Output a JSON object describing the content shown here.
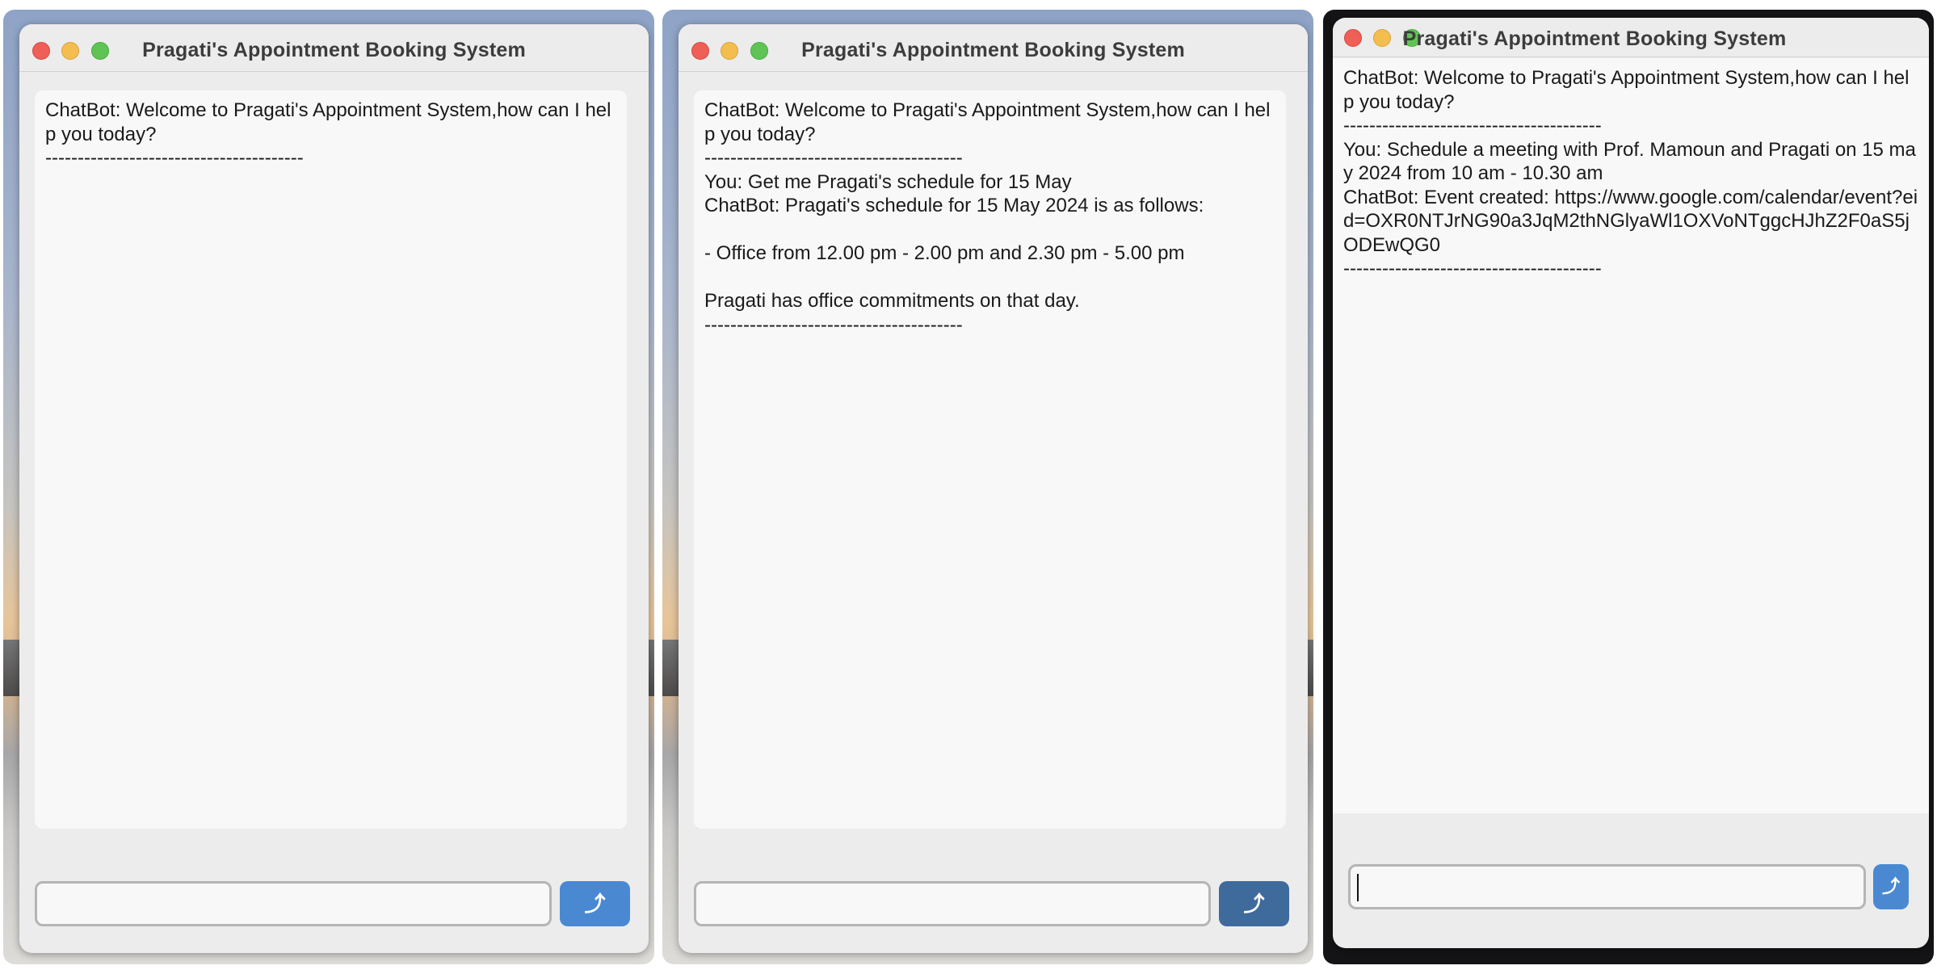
{
  "windows": [
    {
      "title": "Pragati's Appointment Booking System",
      "chat_lines": [
        "ChatBot: Welcome to Pragati's Appointment System,how can I help you today?\n----------------------------------------"
      ],
      "input_value": "",
      "send_icon": "arrow-up-icon",
      "send_glyph": "⤴"
    },
    {
      "title": "Pragati's Appointment Booking System",
      "chat_lines": [
        "ChatBot: Welcome to Pragati's Appointment System,how can I help you today?\n----------------------------------------\nYou: Get me Pragati's schedule for 15 May\nChatBot: Pragati's schedule for 15 May 2024 is as follows:\n\n- Office from 12.00 pm - 2.00 pm and 2.30 pm - 5.00 pm\n\nPragati has office commitments on that day.\n----------------------------------------"
      ],
      "input_value": "",
      "send_icon": "arrow-up-icon",
      "send_glyph": "⤴"
    },
    {
      "title": "Pragati's Appointment Booking System",
      "chat_lines": [
        "ChatBot: Welcome to Pragati's Appointment System,how can I help you today?\n----------------------------------------\nYou: Schedule a meeting with Prof. Mamoun and Pragati on 15 may 2024 from 10 am - 10.30 am\nChatBot: Event created: https://www.google.com/calendar/event?eid=OXR0NTJrNG90a3JqM2thNGlyaWl1OXVoNTggcHJhZ2F0aS5jODEwQG0\n----------------------------------------"
      ],
      "input_value": "",
      "send_icon": "arrow-up-icon",
      "send_glyph": "⤴"
    }
  ]
}
